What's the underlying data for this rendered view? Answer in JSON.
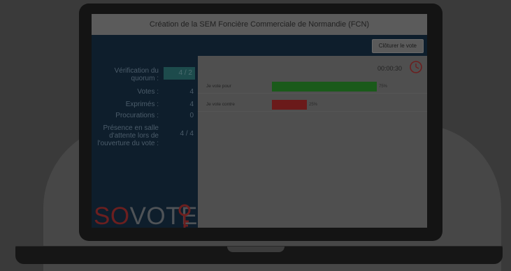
{
  "window": {
    "title": "Création de la SEM Foncière Commerciale de Normandie (FCN)"
  },
  "toolbar": {
    "close_label": "Clôturer le vote"
  },
  "stats": {
    "quorum_label": "Vérification du quorum :",
    "quorum_value": "4 / 2",
    "votes_label": "Votes :",
    "votes_value": "4",
    "exprimes_label": "Exprimés :",
    "exprimes_value": "4",
    "procurations_label": "Procurations :",
    "procurations_value": "0",
    "presence_label": "Présence en salle d'attente lors de l'ouverture du vote :",
    "presence_value": "4 / 4"
  },
  "logo": {
    "so": "SO",
    "vote": "VOTE"
  },
  "timer": {
    "value": "00:00:30"
  },
  "results": [
    {
      "label": "Je vote pour",
      "percent_text": "75%",
      "fraction": 0.75,
      "color": "#1a5a1a"
    },
    {
      "label": "Je vote contre",
      "percent_text": "25%",
      "fraction": 0.25,
      "color": "#6b1a1a"
    }
  ],
  "colors": {
    "accent_red": "#6b1f1f",
    "quorum_box": "#1d4b4c",
    "screen_bg": "#0e1e2c"
  }
}
